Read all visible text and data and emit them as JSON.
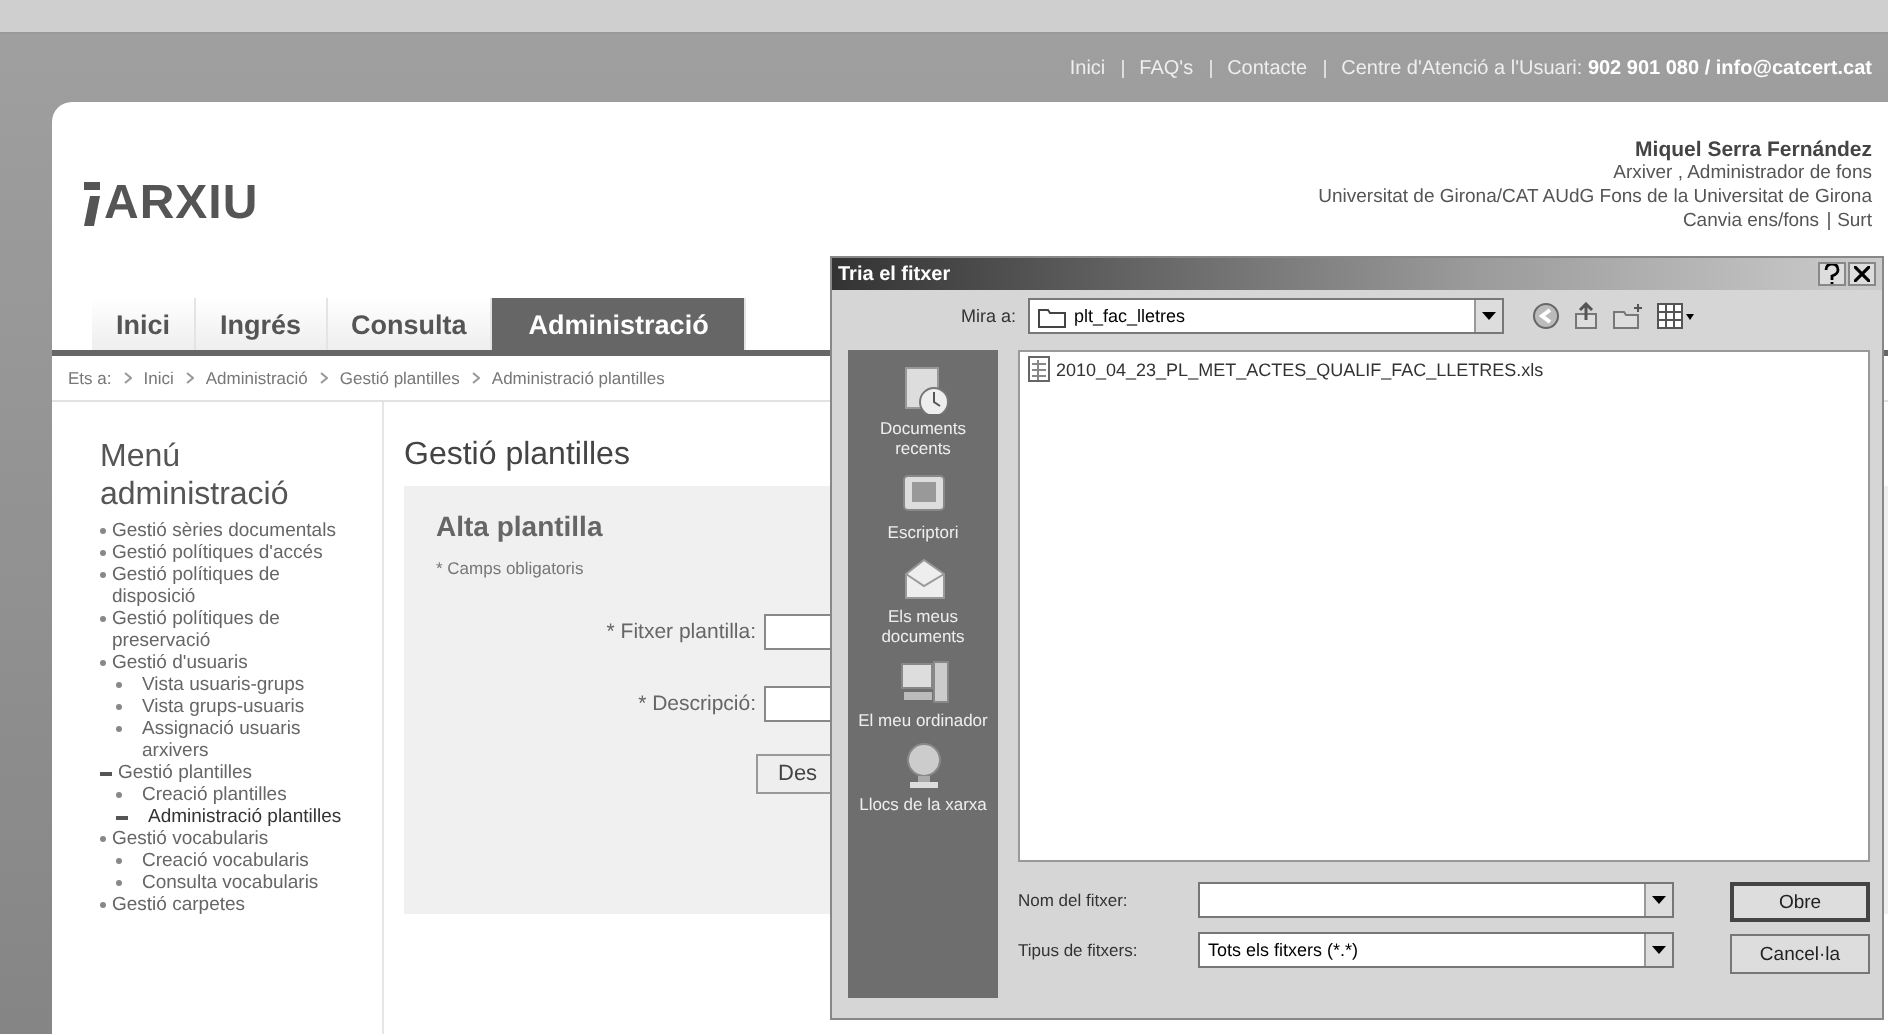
{
  "top_links": [
    {
      "label": "Inici"
    },
    {
      "label": "FAQ's"
    },
    {
      "label": "Contacte"
    },
    {
      "label": "Centre d'Atenció a l'Usuari: **902 901 080 / info@catcert.cat**"
    }
  ],
  "logo": "ARXIU",
  "user": {
    "name": "Miquel Serra Fernández",
    "role": "Arxiver , Administrador de fons",
    "institution": "Universitat de Girona/CAT AUdG Fons de la Universitat de Girona",
    "links": [
      "Canvia ens/fons",
      "Surt"
    ]
  },
  "tabs": [
    {
      "label": "Inici",
      "selected": false
    },
    {
      "label": "Ingrés",
      "selected": false
    },
    {
      "label": "Consulta",
      "selected": false
    },
    {
      "label": "Administració",
      "selected": true
    }
  ],
  "breadcrumb": {
    "prefix": "Ets a:",
    "items": [
      "Inici",
      "Administració",
      "Gestió plantilles",
      "Administració plantilles"
    ]
  },
  "sidebar": {
    "title": "Menú administració",
    "items": [
      {
        "label": "Gestió sèries documentals",
        "expanded": false,
        "selected": false
      },
      {
        "label": "Gestió polítiques d'accés",
        "expanded": false,
        "selected": false
      },
      {
        "label": "Gestió polítiques de disposició",
        "expanded": false,
        "selected": false
      },
      {
        "label": "Gestió polítiques de preservació",
        "expanded": false,
        "selected": false
      },
      {
        "label": "Gestió d'usuaris",
        "expanded": false,
        "selected": false,
        "children": [
          {
            "label": "Vista usuaris-grups",
            "expanded": false,
            "selected": false
          },
          {
            "label": "Vista grups-usuaris",
            "expanded": false,
            "selected": false
          },
          {
            "label": "Assignació usuaris arxivers",
            "expanded": false,
            "selected": false
          }
        ]
      },
      {
        "label": "Gestió plantilles",
        "expanded": true,
        "selected": false,
        "children": [
          {
            "label": "Creació plantilles",
            "expanded": false,
            "selected": false
          },
          {
            "label": "Administració plantilles",
            "expanded": false,
            "selected": true
          }
        ]
      },
      {
        "label": "Gestió vocabularis",
        "expanded": false,
        "selected": false,
        "children": [
          {
            "label": "Creació vocabularis",
            "expanded": false,
            "selected": false
          },
          {
            "label": "Consulta vocabularis",
            "expanded": false,
            "selected": false
          }
        ]
      },
      {
        "label": "Gestió carpetes",
        "expanded": false,
        "selected": false
      }
    ]
  },
  "content": {
    "title": "Gestió plantilles",
    "form_title": "Alta plantilla",
    "required_note": "* Camps obligatoris",
    "fields": [
      {
        "label": "* Fitxer plantilla:"
      },
      {
        "label": "* Descripció:"
      }
    ],
    "button": "Des"
  },
  "dialog": {
    "title": "Tria el fitxer",
    "look_in_label": "Mira a:",
    "look_in_value": "plt_fac_lletres",
    "places": [
      {
        "label": "Documents recents",
        "kind": "recent"
      },
      {
        "label": "Escriptori",
        "kind": "desktop"
      },
      {
        "label": "Els meus documents",
        "kind": "documents"
      },
      {
        "label": "El meu ordinador",
        "kind": "computer"
      },
      {
        "label": "Llocs de la xarxa",
        "kind": "network"
      }
    ],
    "files": [
      {
        "name": "2010_04_23_PL_MET_ACTES_QUALIF_FAC_LLETRES.xls",
        "selected": false
      }
    ],
    "filename_label": "Nom del fitxer:",
    "filetype_label": "Tipus de fitxers:",
    "filetype_value": "Tots els fitxers (*.*)",
    "buttons": [
      "Obre",
      "Cancel·la"
    ]
  }
}
